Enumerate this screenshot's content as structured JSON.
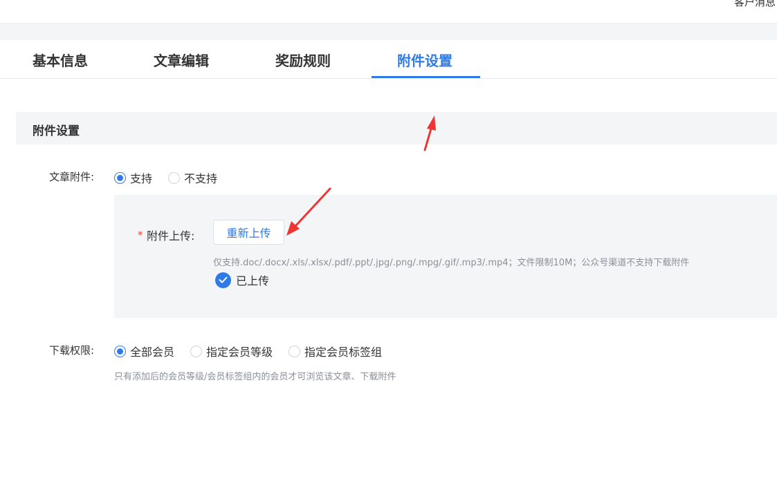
{
  "header": {
    "customer_message": "客户消息"
  },
  "tabs": [
    {
      "label": "基本信息",
      "active": false
    },
    {
      "label": "文章编辑",
      "active": false
    },
    {
      "label": "奖励规则",
      "active": false
    },
    {
      "label": "附件设置",
      "active": true
    }
  ],
  "section": {
    "title": "附件设置"
  },
  "article_attachment": {
    "label": "文章附件:",
    "options": [
      {
        "label": "支持",
        "checked": true
      },
      {
        "label": "不支持",
        "checked": false
      }
    ]
  },
  "upload": {
    "required_mark": "*",
    "label": "附件上传:",
    "button_label": "重新上传",
    "hint": "仅支持.doc/.docx/.xls/.xlsx/.pdf/.ppt/.jpg/.png/.mpg/.gif/.mp3/.mp4；文件限制10M；公众号渠道不支持下载附件",
    "status_label": "已上传"
  },
  "download_permission": {
    "label": "下载权限:",
    "options": [
      {
        "label": "全部会员",
        "checked": true
      },
      {
        "label": "指定会员等级",
        "checked": false
      },
      {
        "label": "指定会员标签组",
        "checked": false
      }
    ],
    "hint": "只有添加后的会员等级/会员标签组内的会员才可浏览该文章、下载附件"
  },
  "colors": {
    "accent": "#2f7be5",
    "annotation_arrow": "#f03434",
    "required": "#e04b3e"
  }
}
